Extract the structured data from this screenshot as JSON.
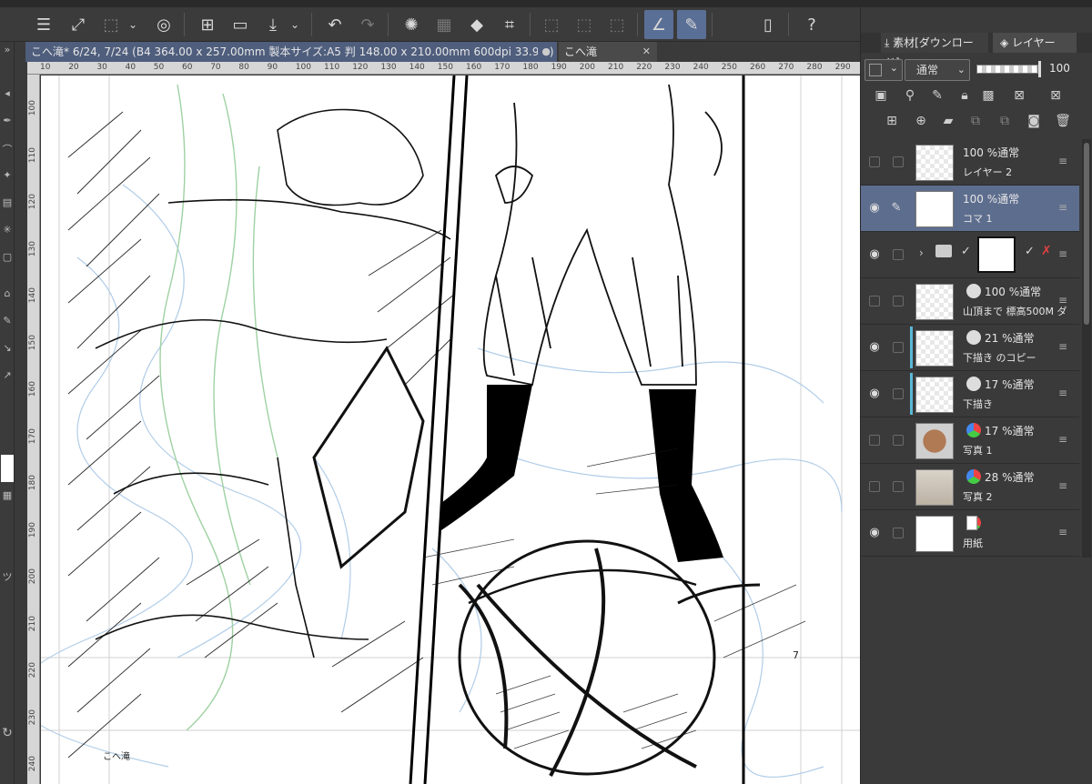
{
  "document_tabs": [
    {
      "label": "こへ滝* 6/24, 7/24 (B4 364.00 x 257.00mm 製本サイズ:A5 判 148.00 x 210.00mm 600dpi 33.9%)",
      "close": "●"
    },
    {
      "label": "こへ滝",
      "close": "✕"
    }
  ],
  "ruler_top_ticks": [
    "10",
    "20",
    "30",
    "40",
    "50",
    "60",
    "70",
    "80",
    "90",
    "100",
    "110",
    "120",
    "130",
    "140",
    "150",
    "160",
    "170",
    "180",
    "190",
    "200",
    "210",
    "220",
    "230",
    "240",
    "250",
    "260",
    "270",
    "280",
    "290"
  ],
  "ruler_left_ticks": [
    "100",
    "110",
    "120",
    "130",
    "140",
    "150",
    "160",
    "170",
    "180",
    "190",
    "200",
    "210",
    "220",
    "230",
    "240"
  ],
  "canvas": {
    "page_number": "7",
    "doc_label": "こへ滝"
  },
  "panel": {
    "tab_material": "素材[ダウンロード]",
    "tab_layer": "レイヤー",
    "blend_mode": "通常",
    "opacity": "100"
  },
  "layers": [
    {
      "line1": "100 %通常",
      "line2": "レイヤー 2",
      "visible": false,
      "selected": false
    },
    {
      "line1": "100 %通常",
      "line2": "コマ 1",
      "visible": true,
      "selected": true
    },
    {
      "line1": "",
      "line2": "",
      "visible": true,
      "selected": false,
      "folder": true
    },
    {
      "line1": "100 %通常",
      "line2": "山頂まで 標高500M ダ",
      "visible": false,
      "selected": false
    },
    {
      "line1": "21 %通常",
      "line2": "下描き のコピー",
      "visible": true,
      "selected": false
    },
    {
      "line1": "17 %通常",
      "line2": "下描き",
      "visible": true,
      "selected": false
    },
    {
      "line1": "17 %通常",
      "line2": "写真 1",
      "visible": false,
      "selected": false
    },
    {
      "line1": "28 %通常",
      "line2": "写真 2",
      "visible": false,
      "selected": false
    },
    {
      "line1": "",
      "line2": "用紙",
      "visible": true,
      "selected": false
    }
  ],
  "colors": {
    "accent": "#5a6f96",
    "selected_layer": "#5d6d8e",
    "draft_layer_bar": "#5bb7d6"
  }
}
